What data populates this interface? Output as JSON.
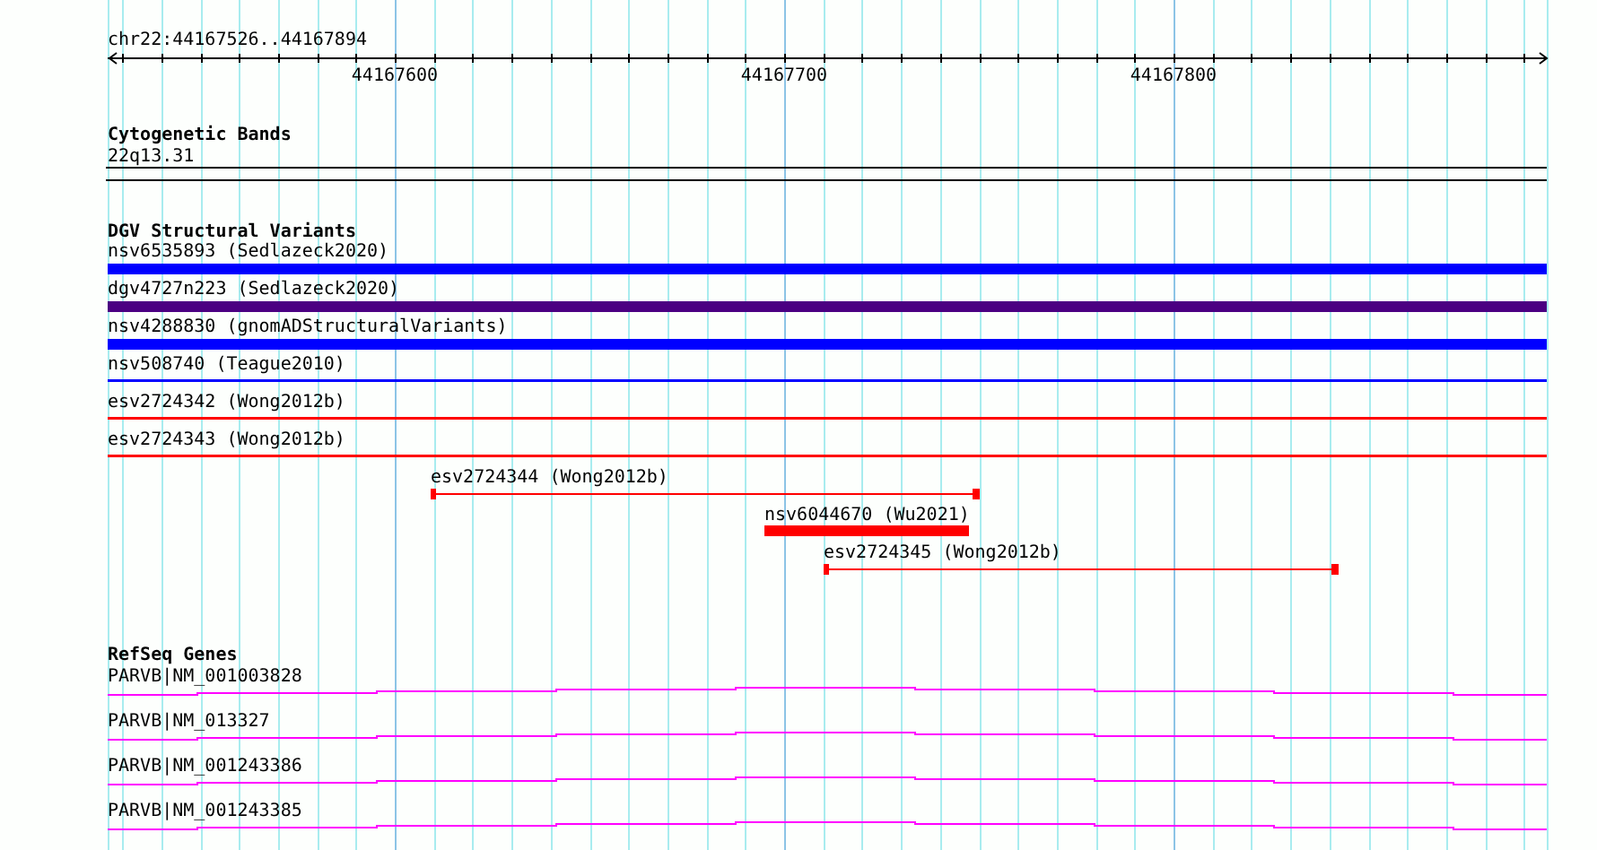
{
  "locus": "chr22:44167526..44167894",
  "ruler": {
    "ticks": [
      "44167600",
      "44167700",
      "44167800"
    ]
  },
  "cytogenetic_bands": {
    "title": "Cytogenetic Bands",
    "band": "22q13.31"
  },
  "dgv": {
    "title": "DGV Structural Variants",
    "features": [
      {
        "label": "nsv6535893 (Sedlazeck2020)",
        "kind": "bar",
        "color": "#0000ff"
      },
      {
        "label": "dgv4727n223 (Sedlazeck2020)",
        "kind": "bar",
        "color": "#4b0082"
      },
      {
        "label": "nsv4288830 (gnomADStructuralVariants)",
        "kind": "bar",
        "color": "#0000ff"
      },
      {
        "label": "nsv508740 (Teague2010)",
        "kind": "line",
        "color": "#0000ff"
      },
      {
        "label": "esv2724342 (Wong2012b)",
        "kind": "line",
        "color": "#ff0000"
      },
      {
        "label": "esv2724343 (Wong2012b)",
        "kind": "line",
        "color": "#ff0000"
      },
      {
        "label": "esv2724344 (Wong2012b)",
        "kind": "capped",
        "color": "#ff0000"
      },
      {
        "label": "nsv6044670 (Wu2021)",
        "kind": "bar",
        "color": "#ff0000"
      },
      {
        "label": "esv2724345 (Wong2012b)",
        "kind": "capped",
        "color": "#ff0000"
      }
    ]
  },
  "refseq": {
    "title": "RefSeq Genes",
    "genes": [
      "PARVB|NM_001003828",
      "PARVB|NM_013327",
      "PARVB|NM_001243386",
      "PARVB|NM_001243385"
    ]
  }
}
